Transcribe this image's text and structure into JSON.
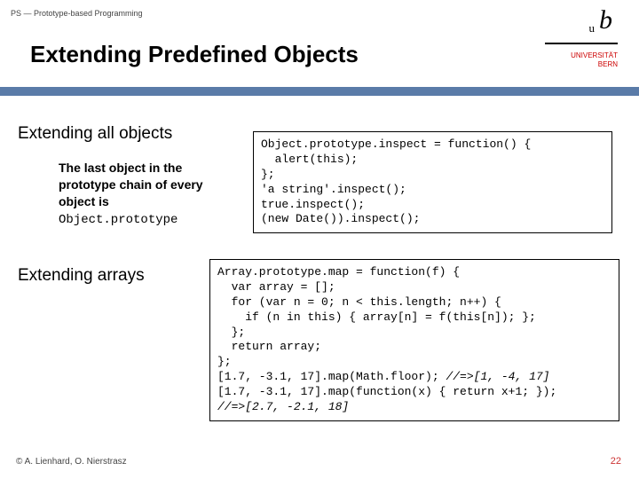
{
  "header": {
    "breadcrumb": "PS — Prototype-based Programming",
    "title": "Extending Predefined Objects"
  },
  "logo": {
    "u": "u",
    "b": "b",
    "line1": "UNIVERSITÄT",
    "line2": "BERN"
  },
  "section1": {
    "heading": "Extending all objects",
    "body_prefix": "The last object in the prototype chain of every object is ",
    "body_mono": "Object.prototype",
    "code_l1": "Object.prototype.inspect = function() {",
    "code_l2": "  alert(this);",
    "code_l3": "};",
    "code_l4": "'a string'.inspect();",
    "code_l5": "true.inspect();",
    "code_l6": "(new Date()).inspect();"
  },
  "section2": {
    "heading": "Extending arrays",
    "code_l1": "Array.prototype.map = function(f) {",
    "code_l2": "  var array = [];",
    "code_l3": "  for (var n = 0; n < this.length; n++) {",
    "code_l4": "    if (n in this) { array[n] = f(this[n]); };",
    "code_l5": "  };",
    "code_l6": "  return array;",
    "code_l7": "};",
    "code_l8a": "[1.7, -3.1, 17].map(Math.floor); ",
    "code_l8b": "//=>[1, -4, 17]",
    "code_l9": "[1.7, -3.1, 17].map(function(x) { return x+1; });",
    "code_l10": "//=>[2.7, -2.1, 18]"
  },
  "footer": {
    "copyright": "© A. Lienhard, O. Nierstrasz",
    "page": "22"
  }
}
